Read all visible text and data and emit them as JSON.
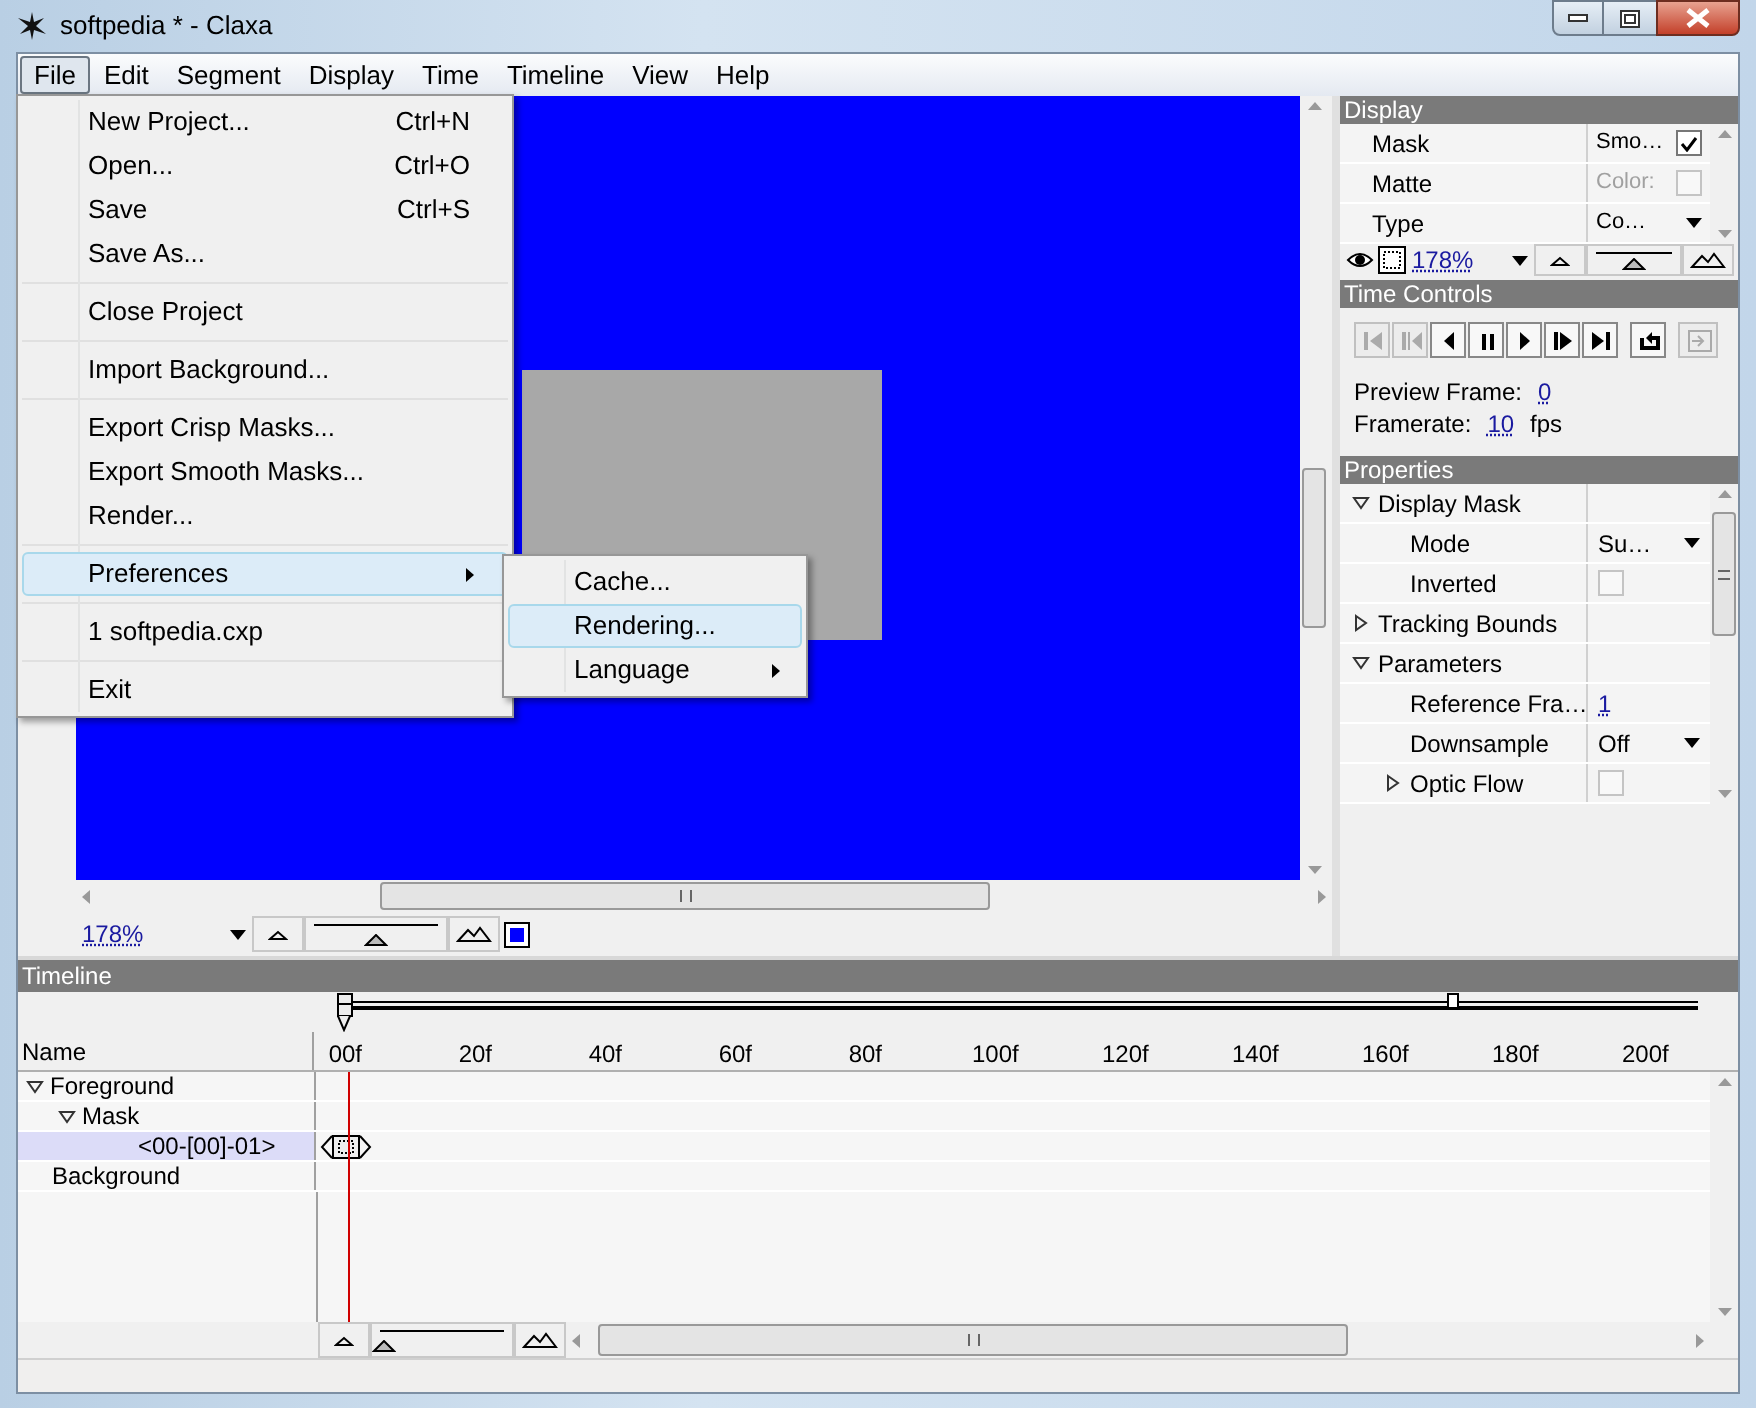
{
  "window": {
    "title": "softpedia * - Claxa"
  },
  "menubar": [
    {
      "label": "File",
      "selected": true
    },
    {
      "label": "Edit",
      "selected": false
    },
    {
      "label": "Segment",
      "selected": false
    },
    {
      "label": "Display",
      "selected": false
    },
    {
      "label": "Time",
      "selected": false
    },
    {
      "label": "Timeline",
      "selected": false
    },
    {
      "label": "View",
      "selected": false
    },
    {
      "label": "Help",
      "selected": false
    }
  ],
  "file_menu": {
    "groups": [
      [
        {
          "label": "New Project...",
          "shortcut": "Ctrl+N",
          "selected": false,
          "submenu": false
        },
        {
          "label": "Open...",
          "shortcut": "Ctrl+O",
          "selected": false,
          "submenu": false
        },
        {
          "label": "Save",
          "shortcut": "Ctrl+S",
          "selected": false,
          "submenu": false
        },
        {
          "label": "Save As...",
          "selected": false,
          "submenu": false
        }
      ],
      [
        {
          "label": "Close Project",
          "selected": false,
          "submenu": false
        }
      ],
      [
        {
          "label": "Import Background...",
          "selected": false,
          "submenu": false
        }
      ],
      [
        {
          "label": "Export Crisp Masks...",
          "selected": false,
          "submenu": false
        },
        {
          "label": "Export Smooth Masks...",
          "selected": false,
          "submenu": false
        },
        {
          "label": "Render...",
          "selected": false,
          "submenu": false
        }
      ],
      [
        {
          "label": "Preferences",
          "selected": true,
          "submenu": true
        }
      ],
      [
        {
          "label": "1 softpedia.cxp",
          "selected": false,
          "submenu": false
        }
      ],
      [
        {
          "label": "Exit",
          "selected": false,
          "submenu": false
        }
      ]
    ]
  },
  "preferences_menu": [
    {
      "label": "Cache...",
      "selected": false,
      "submenu": false
    },
    {
      "label": "Rendering...",
      "selected": true,
      "submenu": false
    },
    {
      "label": "Language",
      "selected": false,
      "submenu": true
    }
  ],
  "canvas": {
    "zoom": "178%",
    "zoom_slider": {
      "level": 0.5
    }
  },
  "display_panel": {
    "title": "Display",
    "rows": [
      {
        "label": "Mask",
        "kind": "check",
        "value": "Smo…",
        "checked": true
      },
      {
        "label": "Matte",
        "kind": "color",
        "value": "Color:",
        "disabled": true
      },
      {
        "label": "Type",
        "kind": "dropdown",
        "value": "Co…"
      }
    ],
    "zoom": "178%",
    "zoom_slider": {
      "level": 0.5
    }
  },
  "time_controls": {
    "title": "Time Controls",
    "buttons": [
      {
        "kind": "first",
        "disabled": true
      },
      {
        "kind": "prev-key",
        "disabled": true
      },
      {
        "kind": "prev",
        "disabled": false
      },
      {
        "kind": "pause",
        "disabled": false
      },
      {
        "kind": "next",
        "disabled": false
      },
      {
        "kind": "next-key",
        "disabled": false
      },
      {
        "kind": "last",
        "disabled": false
      },
      {
        "kind": "loop",
        "disabled": false
      },
      {
        "kind": "export",
        "disabled": true
      }
    ],
    "preview_label": "Preview Frame:",
    "preview_value": "0",
    "framerate_label": "Framerate:",
    "framerate_value": "10",
    "framerate_unit": "fps"
  },
  "properties": {
    "title": "Properties",
    "rows": [
      {
        "label": "Display Mask",
        "expanded": true,
        "children": [
          {
            "label": "Mode",
            "kind": "dropdown",
            "value": "Su…"
          },
          {
            "label": "Inverted",
            "kind": "check",
            "checked": false
          }
        ]
      },
      {
        "label": "Tracking Bounds",
        "expanded": false
      },
      {
        "label": "Parameters",
        "expanded": true,
        "children": [
          {
            "label": "Reference Fra…",
            "kind": "link",
            "value": "1"
          },
          {
            "label": "Downsample",
            "kind": "dropdown",
            "value": "Off"
          },
          {
            "label": "Optic Flow",
            "expanded": false,
            "kind": "check",
            "checked": false
          }
        ]
      }
    ]
  },
  "timeline": {
    "title": "Timeline",
    "name_column": "Name",
    "ticks": [
      "00f",
      "20f",
      "40f",
      "60f",
      "80f",
      "100f",
      "120f",
      "140f",
      "160f",
      "180f",
      "200f"
    ],
    "tracks": [
      {
        "label": "Foreground",
        "expanded": true,
        "selected": false,
        "children": [
          {
            "label": "Mask",
            "expanded": true,
            "selected": false,
            "children": [
              {
                "label": "<00-[00]-01>",
                "selected": true,
                "keyframe": true
              }
            ]
          }
        ]
      },
      {
        "label": "Background",
        "selected": false
      }
    ],
    "zoom_slider": {
      "level": 0.08
    }
  }
}
